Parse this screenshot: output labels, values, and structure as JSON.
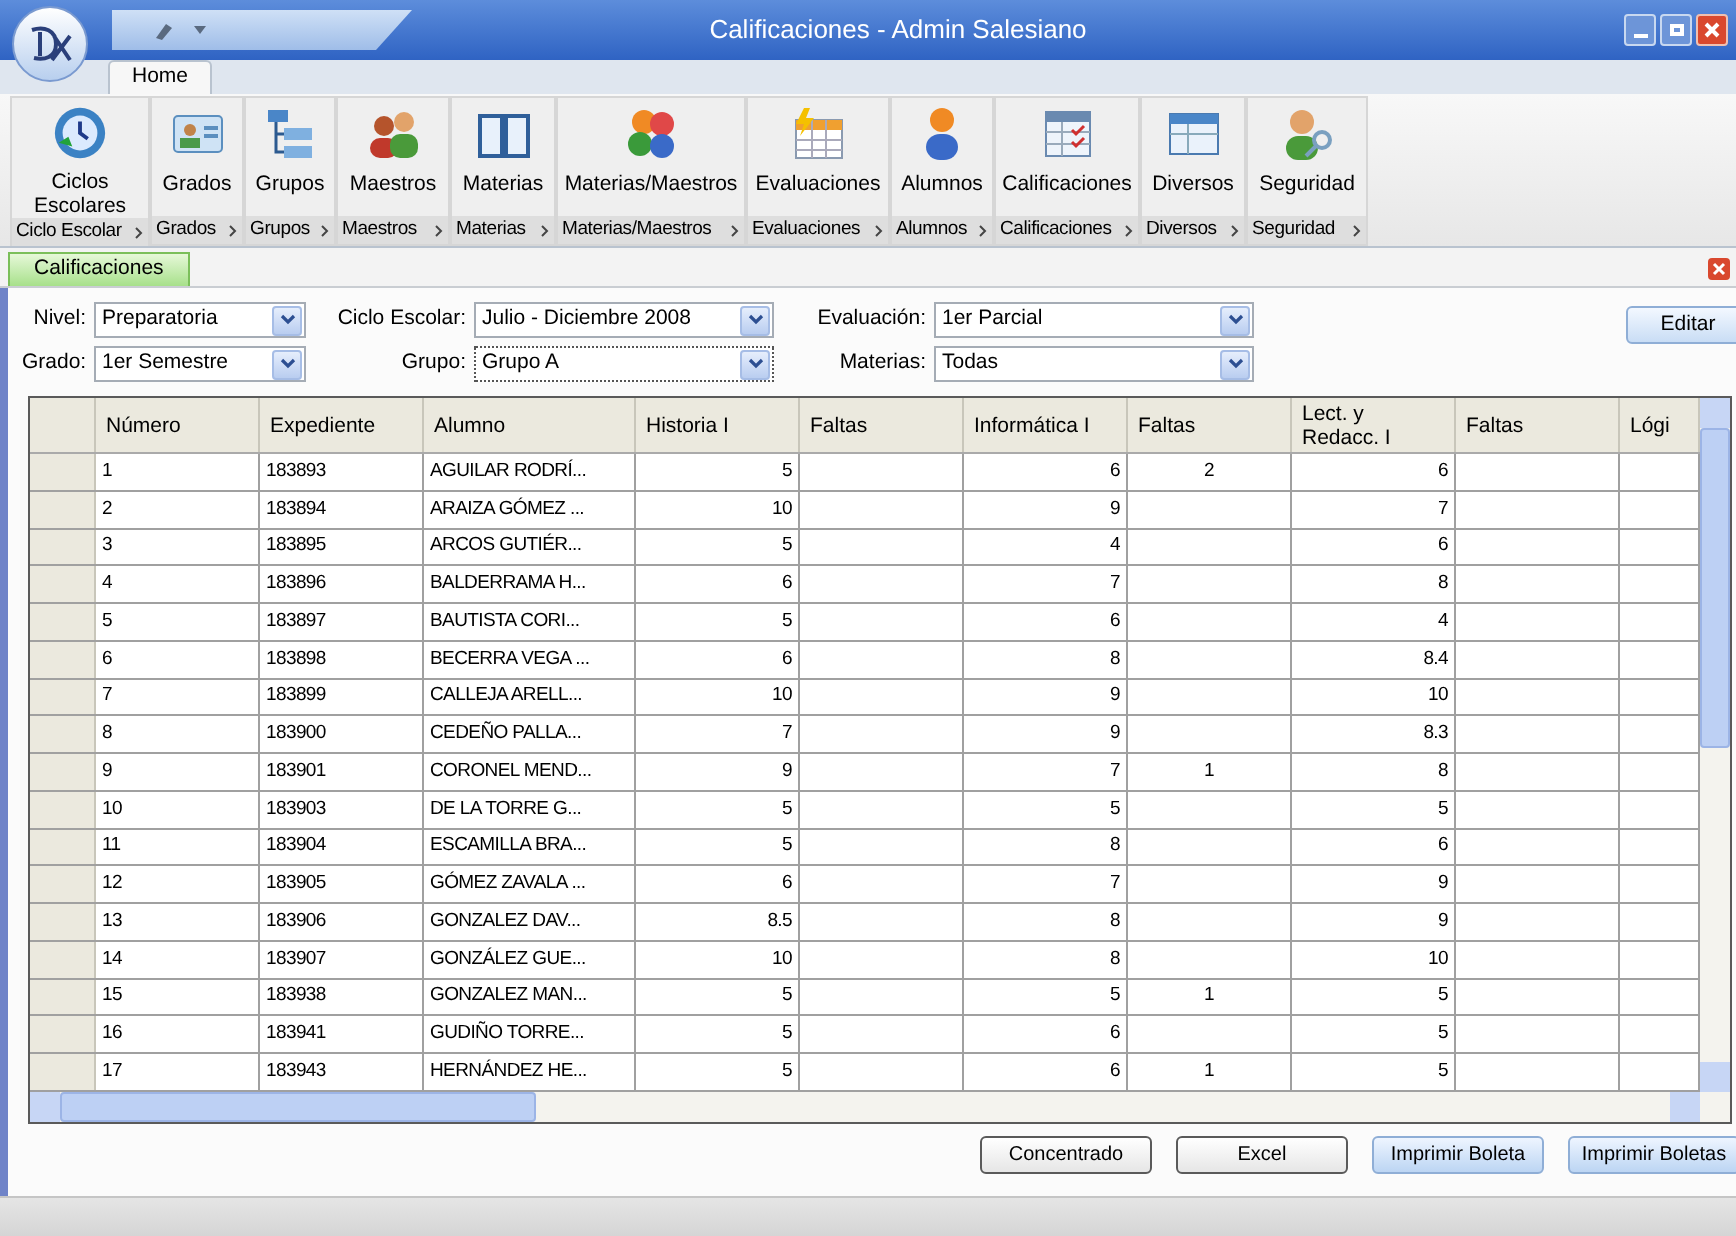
{
  "window": {
    "title": "Calificaciones - Admin Salesiano"
  },
  "ribbon": {
    "tabs": [
      {
        "label": "Home",
        "selected": true
      }
    ],
    "groups": [
      {
        "button": "Ciclos Escolares",
        "label": "Ciclo Escolar"
      },
      {
        "button": "Grados",
        "label": "Grados"
      },
      {
        "button": "Grupos",
        "label": "Grupos"
      },
      {
        "button": "Maestros",
        "label": "Maestros"
      },
      {
        "button": "Materias",
        "label": "Materias"
      },
      {
        "button": "Materias/Maestros",
        "label": "Materias/Maestros"
      },
      {
        "button": "Evaluaciones",
        "label": "Evaluaciones"
      },
      {
        "button": "Alumnos",
        "label": "Alumnos"
      },
      {
        "button": "Calificaciones",
        "label": "Calificaciones"
      },
      {
        "button": "Diversos",
        "label": "Diversos"
      },
      {
        "button": "Seguridad",
        "label": "Seguridad"
      }
    ]
  },
  "document_tabs": [
    {
      "label": "Calificaciones",
      "selected": true
    }
  ],
  "filters": [
    {
      "label": "Nivel:",
      "value": "Preparatoria",
      "focused": false
    },
    {
      "label": "Ciclo Escolar:",
      "value": "Julio - Diciembre 2008",
      "focused": false
    },
    {
      "label": "Evaluación:",
      "value": "1er Parcial",
      "focused": false
    },
    {
      "label": "Grado:",
      "value": "1er Semestre",
      "focused": false
    },
    {
      "label": "Grupo:",
      "value": "Grupo A",
      "focused": true
    },
    {
      "label": "Materias:",
      "value": "Todas",
      "focused": false
    }
  ],
  "edit_button": "Editar",
  "table": {
    "columns": [
      {
        "label": "Número",
        "kind": "text"
      },
      {
        "label": "Expediente",
        "kind": "text"
      },
      {
        "label": "Alumno",
        "kind": "text"
      },
      {
        "label": "Historia I",
        "kind": "grade"
      },
      {
        "label": "Faltas",
        "kind": "absence"
      },
      {
        "label": "Informática I",
        "kind": "grade"
      },
      {
        "label": "Faltas",
        "kind": "absence"
      },
      {
        "label": "Lect. y Redacc. I",
        "kind": "grade"
      },
      {
        "label": "Faltas",
        "kind": "absence"
      },
      {
        "label": "Lógi",
        "kind": "grade"
      }
    ],
    "rows": [
      [
        "1",
        "183893",
        "AGUILAR RODRÍ...",
        "5",
        null,
        "6",
        "2",
        "6",
        null,
        null
      ],
      [
        "2",
        "183894",
        "ARAIZA GÓMEZ ...",
        "10",
        null,
        "9",
        null,
        "7",
        null,
        null
      ],
      [
        "3",
        "183895",
        "ARCOS GUTIÉR...",
        "5",
        null,
        "4",
        null,
        "6",
        null,
        null
      ],
      [
        "4",
        "183896",
        "BALDERRAMA H...",
        "6",
        null,
        "7",
        null,
        "8",
        null,
        null
      ],
      [
        "5",
        "183897",
        "BAUTISTA CORI...",
        "5",
        null,
        "6",
        null,
        "4",
        null,
        null
      ],
      [
        "6",
        "183898",
        "BECERRA VEGA ...",
        "6",
        null,
        "8",
        null,
        "8.4",
        null,
        null
      ],
      [
        "7",
        "183899",
        "CALLEJA ARELL...",
        "10",
        null,
        "9",
        null,
        "10",
        null,
        null
      ],
      [
        "8",
        "183900",
        "CEDEÑO PALLA...",
        "7",
        null,
        "9",
        null,
        "8.3",
        null,
        null
      ],
      [
        "9",
        "183901",
        "CORONEL MEND...",
        "9",
        null,
        "7",
        "1",
        "8",
        null,
        null
      ],
      [
        "10",
        "183903",
        "DE LA TORRE G...",
        "5",
        null,
        "5",
        null,
        "5",
        null,
        null
      ],
      [
        "11",
        "183904",
        "ESCAMILLA BRA...",
        "5",
        null,
        "8",
        null,
        "6",
        null,
        null
      ],
      [
        "12",
        "183905",
        "GÓMEZ ZAVALA ...",
        "6",
        null,
        "7",
        null,
        "9",
        null,
        null
      ],
      [
        "13",
        "183906",
        "GONZALEZ DAV...",
        "8.5",
        null,
        "8",
        null,
        "9",
        null,
        null
      ],
      [
        "14",
        "183907",
        "GONZÁLEZ GUE...",
        "10",
        null,
        "8",
        null,
        "10",
        null,
        null
      ],
      [
        "15",
        "183938",
        "GONZALEZ MAN...",
        "5",
        null,
        "5",
        "1",
        "5",
        null,
        null
      ],
      [
        "16",
        "183941",
        "GUDIÑO TORRE...",
        "5",
        null,
        "6",
        null,
        "5",
        null,
        null
      ],
      [
        "17",
        "183943",
        "HERNÁNDEZ HE...",
        "5",
        null,
        "6",
        "1",
        "5",
        null,
        null
      ]
    ]
  },
  "buttons": [
    {
      "label": "Concentrado",
      "kind": "default"
    },
    {
      "label": "Excel",
      "kind": "default"
    },
    {
      "label": "Imprimir Boleta",
      "kind": "accent"
    },
    {
      "label": "Imprimir Boletas",
      "kind": "accent"
    }
  ]
}
